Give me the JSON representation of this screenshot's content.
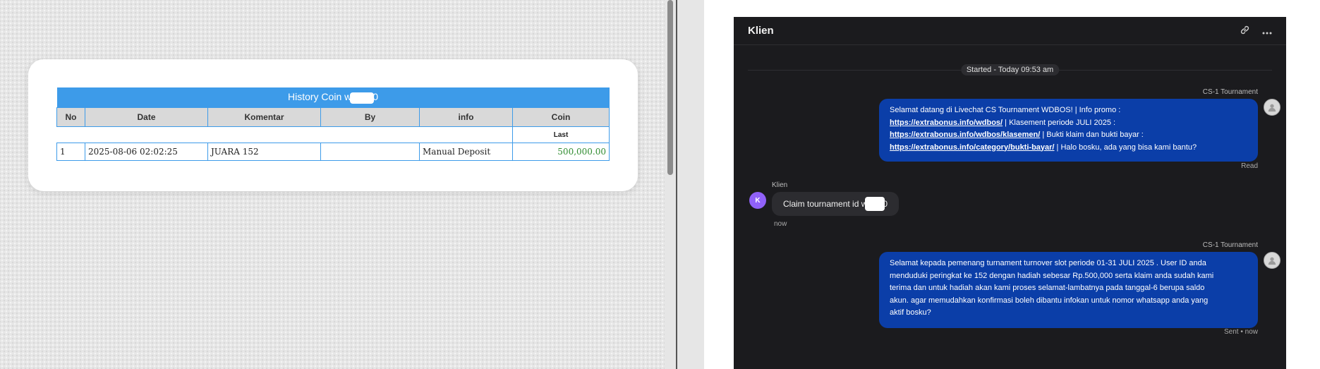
{
  "coin_history": {
    "title_prefix": "History Coin w",
    "title_suffix": "0",
    "columns": [
      "No",
      "Date",
      "Komentar",
      "By",
      "info",
      "Coin"
    ],
    "sub_header_last": "Last",
    "rows": [
      {
        "no": "1",
        "date": "2025-08-06 02:02:25",
        "komentar": "JUARA 152",
        "by": "",
        "info": "Manual Deposit",
        "coin": "500,000.00"
      }
    ]
  },
  "chat": {
    "title": "Klien",
    "header_icons": [
      "link-icon",
      "more-icon"
    ],
    "started": "Started - Today 09:53 am",
    "messages": [
      {
        "sender": "CS-1 Tournament",
        "line1": "Selamat datang di Livechat CS Tournament WDBOS! | Info promo :",
        "link1": "https://extrabonus.info/wdbos/",
        "text2": " | Klasement periode JULI 2025 :",
        "link2": "https://extrabonus.info/wdbos/klasemen/",
        "text3": " | Bukti klaim dan bukti bayar :",
        "link3": "https://extrabonus.info/category/bukti-bayar/",
        "text4": " | Halo bosku, ada yang bisa kami bantu?",
        "status": "Read"
      },
      {
        "sender": "Klien",
        "avatar_letter": "K",
        "text_prefix": "Claim tournament id w",
        "text_suffix": "0",
        "status": "now"
      },
      {
        "sender": "CS-1 Tournament",
        "lines": [
          "Selamat kepada pemenang turnament turnover slot periode 01-31 JULI 2025 . User ID anda",
          "menduduki peringkat ke 152 dengan hadiah sebesar Rp.500,000 serta klaim anda sudah kami",
          "terima dan untuk hadiah akan kami proses selamat-lambatnya pada tanggal-6 berupa saldo",
          "akun. agar memudahkan konfirmasi boleh dibantu infokan untuk nomor whatsapp anda yang",
          "aktif bosku?"
        ],
        "status": "Sent • now"
      }
    ]
  },
  "colors": {
    "table_accent": "#3d9be9",
    "agent_bubble": "#0b3ea8",
    "client_avatar": "#9061f9",
    "chat_bg": "#1b1b1e"
  }
}
